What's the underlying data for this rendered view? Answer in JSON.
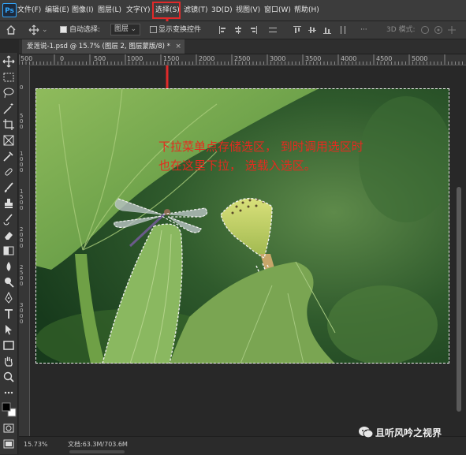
{
  "app": {
    "logo": "Ps"
  },
  "menu": {
    "items": [
      {
        "label": "文件(F)"
      },
      {
        "label": "编辑(E)"
      },
      {
        "label": "图像(I)"
      },
      {
        "label": "图层(L)"
      },
      {
        "label": "文字(Y)"
      },
      {
        "label": "选择(S)"
      },
      {
        "label": "滤镜(T)"
      },
      {
        "label": "3D(D)"
      },
      {
        "label": "视图(V)"
      },
      {
        "label": "窗口(W)"
      },
      {
        "label": "帮助(H)"
      }
    ],
    "highlighted": "选择(S)"
  },
  "options": {
    "auto_select_label": "自动选择:",
    "auto_select_checked": true,
    "layer_dropdown": "图层",
    "show_transform_label": "显示变换控件",
    "show_transform_checked": false,
    "mode_3d_label": "3D 模式:"
  },
  "document": {
    "tab_title": "爱莲说-1.psd @ 15.7% (图层 2, 图层蒙版/8) *",
    "close_glyph": "×"
  },
  "ruler": {
    "top_labels": [
      "500",
      "0",
      "500",
      "1000",
      "1500",
      "2000",
      "2500",
      "3000",
      "3500",
      "4000",
      "4500",
      "5000"
    ],
    "left_labels": [
      "0",
      "500",
      "1000",
      "1500",
      "2000",
      "2500",
      "3000"
    ]
  },
  "annotation": {
    "line1": "下拉菜单点存储选区，  到时调用选区时",
    "line2": "也在这里下拉，   选载入选区。",
    "color": "#e62a1f"
  },
  "status": {
    "zoom": "15.73%",
    "doc_size": "文档:63.3M/703.6M",
    "arrow": "›"
  },
  "watermark": {
    "text": "且听风吟之视界"
  },
  "colors": {
    "accent": "#31a8ff",
    "highlight": "#e02a2a",
    "marquee": "#f2f2f2"
  },
  "icons": {
    "toolbar": [
      "move-icon",
      "marquee-icon",
      "lasso-icon",
      "magic-wand-icon",
      "crop-icon",
      "frame-icon",
      "eyedropper-icon",
      "healing-brush-icon",
      "brush-icon",
      "clone-stamp-icon",
      "history-brush-icon",
      "eraser-icon",
      "gradient-icon",
      "blur-icon",
      "dodge-icon",
      "pen-icon",
      "type-icon",
      "path-select-icon",
      "rectangle-icon",
      "hand-icon",
      "zoom-icon",
      "more-icon",
      "color-swatches-icon",
      "quick-mask-icon",
      "screen-mode-icon"
    ]
  }
}
